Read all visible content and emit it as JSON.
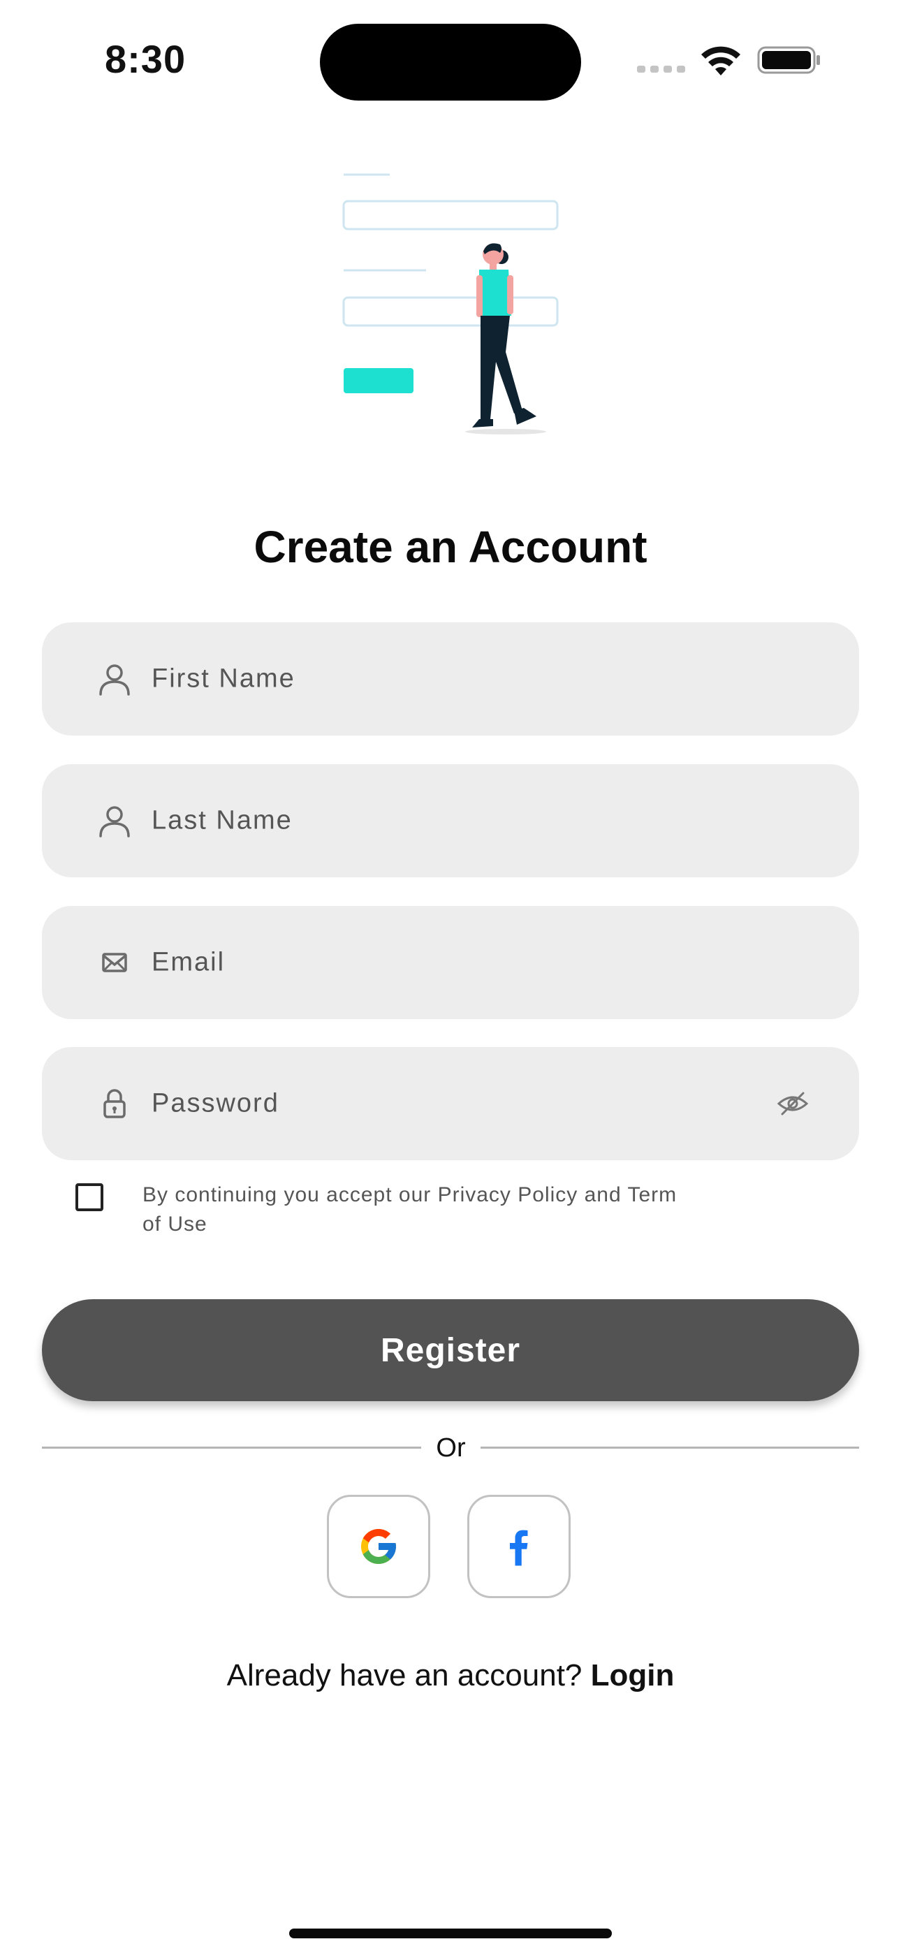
{
  "status_bar": {
    "time": "8:30"
  },
  "page": {
    "title": "Create an Account"
  },
  "form": {
    "first_name": {
      "placeholder": "First Name",
      "icon": "person-icon"
    },
    "last_name": {
      "placeholder": "Last Name",
      "icon": "person-icon"
    },
    "email": {
      "placeholder": "Email",
      "icon": "mail-icon"
    },
    "password": {
      "placeholder": "Password",
      "icon": "lock-icon",
      "toggle_icon": "eye-off-icon"
    },
    "terms_text": "By continuing you accept our Privacy Policy and Term of Use",
    "terms_checked": false
  },
  "actions": {
    "register_label": "Register",
    "divider_label": "Or",
    "social": [
      "google-icon",
      "facebook-icon"
    ],
    "login_prompt": "Already have an account?",
    "login_label": "Login"
  },
  "colors": {
    "accent": "#1ee0d0",
    "button": "#535353",
    "field_bg": "#ededed"
  }
}
